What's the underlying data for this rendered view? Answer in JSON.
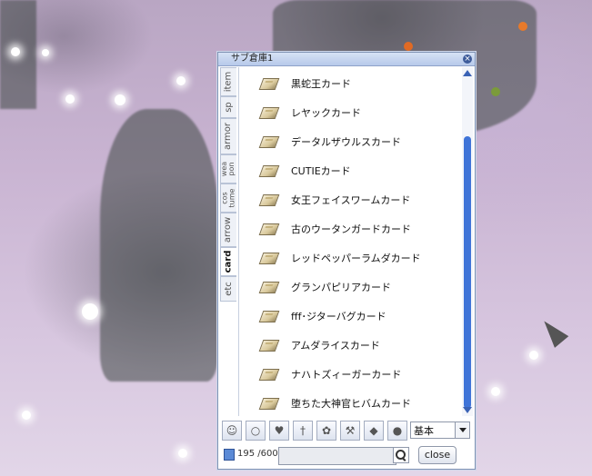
{
  "window": {
    "title": "サブ倉庫1"
  },
  "tabs": [
    {
      "label": "item"
    },
    {
      "label": "sp"
    },
    {
      "label": "armor"
    },
    {
      "label": "wea\npon"
    },
    {
      "label": "cos\ntume"
    },
    {
      "label": "arrow"
    },
    {
      "label": "card",
      "active": true
    },
    {
      "label": "etc"
    }
  ],
  "items": [
    "黒蛇王カード",
    "レヤックカード",
    "データルザウルスカード",
    "CUTIEカード",
    "女王フェイスワームカード",
    "古のウータンガードカード",
    "レッドペッパーラムダカード",
    "グランパピリアカード",
    "fff･ジターバグカード",
    "アムダライスカード",
    "ナハトズィーガーカード",
    "堕ちた大神官ヒバムカード"
  ],
  "toolbar": {
    "icons": [
      "doll-icon",
      "ring-icon",
      "armor-icon",
      "dagger-icon",
      "gear-icon",
      "tool-icon",
      "diamond-icon",
      "orb-icon"
    ],
    "filter_value": "基本"
  },
  "storage": {
    "count": "195 /600",
    "search_value": ""
  },
  "buttons": {
    "close": "close"
  }
}
